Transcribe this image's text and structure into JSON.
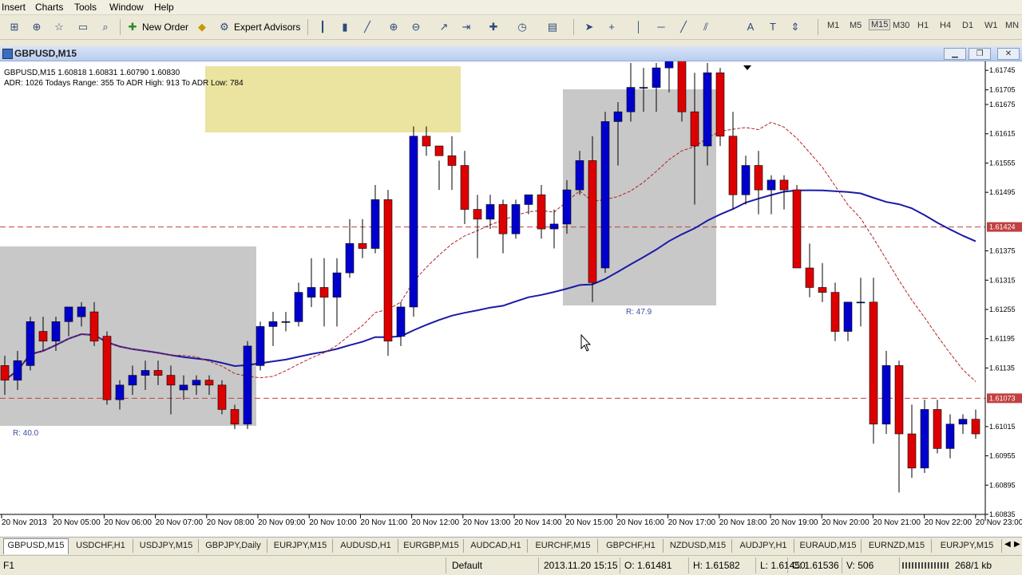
{
  "menu": {
    "items": [
      "Insert",
      "Charts",
      "Tools",
      "Window",
      "Help"
    ]
  },
  "toolbar": {
    "new_order_label": "New Order",
    "expert_advisors_label": "Expert Advisors",
    "timeframes": [
      "M1",
      "M5",
      "M15",
      "M30",
      "H1",
      "H4",
      "D1",
      "W1",
      "MN"
    ],
    "selected_timeframe": "M15"
  },
  "window": {
    "title": "GBPUSD,M15"
  },
  "chart_data": {
    "type": "candlestick",
    "symbol_header": "GBPUSD,M15  1.60818 1.60831 1.60790 1.60830",
    "indicator_line": "ADR: 1026  Todays Range: 355  To ADR High: 913  To ADR Low: 784",
    "price_labels": [
      "1.61705",
      "1.61675",
      "1.61615",
      "1.61555",
      "1.61495",
      "1.61375",
      "1.61315",
      "1.61255",
      "1.61195",
      "1.61135",
      "1.61015",
      "1.60955",
      "1.60895",
      "1.60835"
    ],
    "price_label_values": [
      1.61745,
      1.61705,
      1.61675,
      1.61615,
      1.61555,
      1.61495,
      1.61375,
      1.61315,
      1.61255,
      1.61195,
      1.61135,
      1.61015,
      1.60955,
      1.60895,
      1.60835
    ],
    "price_label_texts": [
      "1.61745",
      "1.61705",
      "1.61675",
      "1.61615",
      "1.61555",
      "1.61495",
      "1.61375",
      "1.61315",
      "1.61255",
      "1.61195",
      "1.61135",
      "1.61015",
      "1.60955",
      "1.60895",
      "1.60835"
    ],
    "hline_labels": [
      {
        "price": 1.61424,
        "text": "1.61424"
      },
      {
        "price": 1.61073,
        "text": "1.61073"
      }
    ],
    "range_labels": [
      "R: 40.0",
      "R: 47.9"
    ],
    "time_labels": [
      "20 Nov 2013",
      "20 Nov 05:00",
      "20 Nov 06:00",
      "20 Nov 07:00",
      "20 Nov 08:00",
      "20 Nov 09:00",
      "20 Nov 10:00",
      "20 Nov 11:00",
      "20 Nov 12:00",
      "20 Nov 13:00",
      "20 Nov 14:00",
      "20 Nov 15:00",
      "20 Nov 16:00",
      "20 Nov 17:00",
      "20 Nov 18:00",
      "20 Nov 19:00",
      "20 Nov 20:00",
      "20 Nov 21:00",
      "20 Nov 22:00",
      "20 Nov 23:00"
    ],
    "ylim": [
      1.60835,
      1.6176
    ],
    "candles": [
      [
        1.6114,
        1.6116,
        1.6108,
        1.6111
      ],
      [
        1.6111,
        1.6117,
        1.6109,
        1.6115
      ],
      [
        1.6114,
        1.6124,
        1.6113,
        1.6123
      ],
      [
        1.6121,
        1.6124,
        1.6117,
        1.6119
      ],
      [
        1.6119,
        1.6124,
        1.6117,
        1.6123
      ],
      [
        1.6123,
        1.6126,
        1.612,
        1.6126
      ],
      [
        1.6124,
        1.6127,
        1.6122,
        1.6126
      ],
      [
        1.6125,
        1.6127,
        1.6118,
        1.6119
      ],
      [
        1.612,
        1.6121,
        1.6106,
        1.6107
      ],
      [
        1.6107,
        1.6111,
        1.6105,
        1.611
      ],
      [
        1.611,
        1.6114,
        1.6108,
        1.6112
      ],
      [
        1.6112,
        1.6115,
        1.6109,
        1.6113
      ],
      [
        1.6113,
        1.6115,
        1.611,
        1.6112
      ],
      [
        1.6112,
        1.6114,
        1.6104,
        1.611
      ],
      [
        1.6109,
        1.6112,
        1.6107,
        1.611
      ],
      [
        1.611,
        1.6112,
        1.6108,
        1.6111
      ],
      [
        1.6111,
        1.6112,
        1.6108,
        1.611
      ],
      [
        1.611,
        1.6111,
        1.6104,
        1.6105
      ],
      [
        1.6105,
        1.6106,
        1.6101,
        1.6102
      ],
      [
        1.6102,
        1.6119,
        1.6101,
        1.6118
      ],
      [
        1.6114,
        1.6123,
        1.6113,
        1.6122
      ],
      [
        1.6122,
        1.6125,
        1.6118,
        1.6123
      ],
      [
        1.6123,
        1.6125,
        1.6121,
        1.6123
      ],
      [
        1.6123,
        1.6131,
        1.6122,
        1.6129
      ],
      [
        1.6128,
        1.6136,
        1.6126,
        1.613
      ],
      [
        1.613,
        1.6136,
        1.6122,
        1.6128
      ],
      [
        1.6128,
        1.6136,
        1.6122,
        1.6133
      ],
      [
        1.6133,
        1.6144,
        1.6132,
        1.6139
      ],
      [
        1.6139,
        1.6144,
        1.6136,
        1.6138
      ],
      [
        1.6138,
        1.6151,
        1.6137,
        1.6148
      ],
      [
        1.6148,
        1.615,
        1.6116,
        1.6119
      ],
      [
        1.612,
        1.6127,
        1.6118,
        1.6126
      ],
      [
        1.6126,
        1.6163,
        1.6124,
        1.6161
      ],
      [
        1.6161,
        1.6163,
        1.6157,
        1.6159
      ],
      [
        1.6159,
        1.6156,
        1.615,
        1.6157
      ],
      [
        1.6157,
        1.6161,
        1.615,
        1.6155
      ],
      [
        1.6155,
        1.6158,
        1.6143,
        1.6146
      ],
      [
        1.6146,
        1.6149,
        1.6136,
        1.6144
      ],
      [
        1.6144,
        1.6149,
        1.6142,
        1.6147
      ],
      [
        1.6147,
        1.6148,
        1.6137,
        1.6141
      ],
      [
        1.6141,
        1.6148,
        1.614,
        1.6147
      ],
      [
        1.6147,
        1.6149,
        1.6145,
        1.6149
      ],
      [
        1.6149,
        1.6151,
        1.614,
        1.6142
      ],
      [
        1.6142,
        1.6146,
        1.6138,
        1.6143
      ],
      [
        1.6143,
        1.6152,
        1.6141,
        1.615
      ],
      [
        1.615,
        1.6158,
        1.6149,
        1.6156
      ],
      [
        1.6156,
        1.6161,
        1.6127,
        1.6131
      ],
      [
        1.6134,
        1.6166,
        1.6133,
        1.6164
      ],
      [
        1.6164,
        1.6168,
        1.6155,
        1.6166
      ],
      [
        1.6166,
        1.6176,
        1.6164,
        1.6171
      ],
      [
        1.6171,
        1.6175,
        1.6166,
        1.6171
      ],
      [
        1.6171,
        1.6176,
        1.6166,
        1.6175
      ],
      [
        1.6175,
        1.6177,
        1.617,
        1.6181
      ],
      [
        1.6181,
        1.6182,
        1.6164,
        1.6166
      ],
      [
        1.6166,
        1.6174,
        1.6147,
        1.6159
      ],
      [
        1.6159,
        1.6176,
        1.6155,
        1.6174
      ],
      [
        1.6174,
        1.6175,
        1.6159,
        1.6161
      ],
      [
        1.6161,
        1.6166,
        1.6146,
        1.6149
      ],
      [
        1.6149,
        1.6157,
        1.6147,
        1.6155
      ],
      [
        1.6155,
        1.6158,
        1.6145,
        1.615
      ],
      [
        1.615,
        1.6153,
        1.6145,
        1.6152
      ],
      [
        1.6152,
        1.6153,
        1.6146,
        1.615
      ],
      [
        1.615,
        1.6151,
        1.6136,
        1.6134
      ],
      [
        1.6134,
        1.6139,
        1.6128,
        1.613
      ],
      [
        1.613,
        1.6135,
        1.6127,
        1.6129
      ],
      [
        1.6129,
        1.6131,
        1.6119,
        1.6121
      ],
      [
        1.6121,
        1.6127,
        1.6119,
        1.6127
      ],
      [
        1.6127,
        1.6132,
        1.6122,
        1.6127
      ],
      [
        1.6127,
        1.6132,
        1.6098,
        1.6102
      ],
      [
        1.6102,
        1.6117,
        1.61,
        1.6114
      ],
      [
        1.6114,
        1.6115,
        1.6088,
        1.61
      ],
      [
        1.61,
        1.6106,
        1.6091,
        1.6093
      ],
      [
        1.6093,
        1.6107,
        1.6092,
        1.6105
      ],
      [
        1.6105,
        1.6107,
        1.6096,
        1.6097
      ],
      [
        1.6097,
        1.6104,
        1.6095,
        1.6102
      ],
      [
        1.6102,
        1.6104,
        1.61,
        1.6103
      ],
      [
        1.6103,
        1.6105,
        1.6099,
        1.61
      ]
    ],
    "colors": {
      "bull": "#0000cc",
      "bear": "#dd0000",
      "ma_slow": "#1a1aa8",
      "ma_fast": "#b22222",
      "hline": "#c24040",
      "box_gray": "#c8c8c8",
      "box_yellow": "#ebe3a0"
    }
  },
  "tabs": {
    "items": [
      "GBPUSD,M15",
      "USDCHF,H1",
      "USDJPY,M15",
      "GBPJPY,Daily",
      "EURJPY,M15",
      "AUDUSD,H1",
      "EURGBP,M15",
      "AUDCAD,H1",
      "EURCHF,M15",
      "GBPCHF,H1",
      "NZDUSD,M15",
      "AUDJPY,H1",
      "EURAUD,M15",
      "EURNZD,M15",
      "EURJPY,M15"
    ]
  },
  "status": {
    "help": "F1",
    "profile": "Default",
    "datetime": "2013.11.20 15:15",
    "open": "O: 1.61481",
    "high": "H: 1.61582",
    "low": "L: 1.61450",
    "close": "C: 1.61536",
    "volume": "V: 506",
    "traffic": "268/1 kb"
  }
}
